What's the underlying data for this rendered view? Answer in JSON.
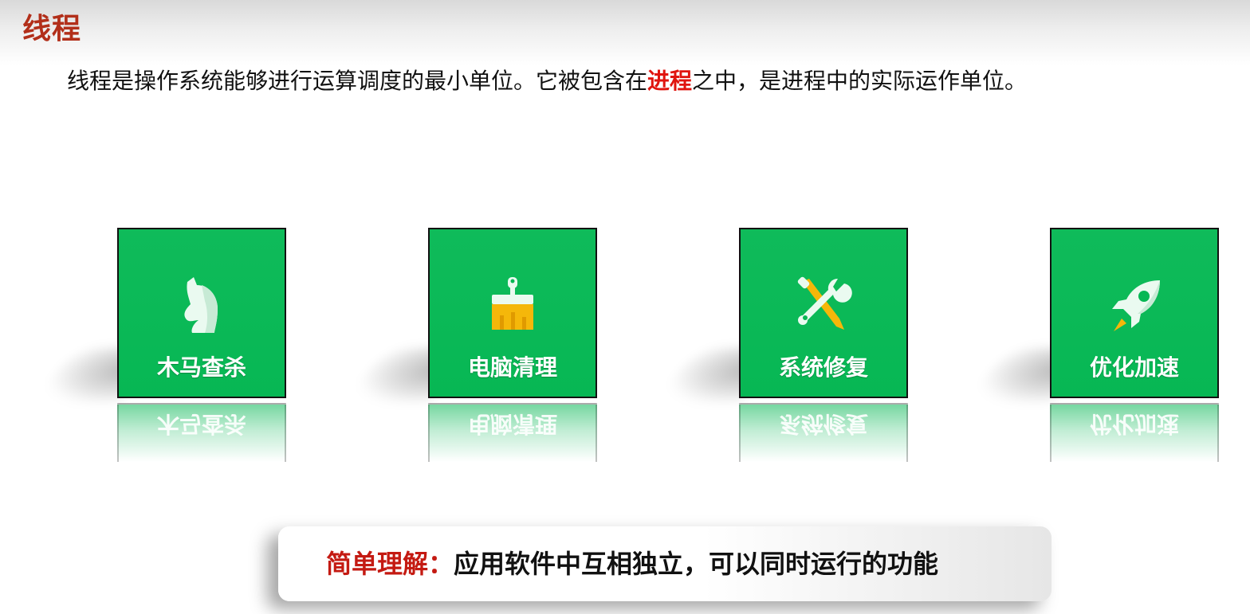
{
  "slide": {
    "title": "线程",
    "definition_part1": "线程是操作系统能够进行运算调度的最小单位。它被包含在",
    "definition_highlight": "进程",
    "definition_part2": "之中，是进程中的实际运作单位。"
  },
  "tiles": [
    {
      "label": "木马查杀",
      "icon": "horse-icon"
    },
    {
      "label": "电脑清理",
      "icon": "broom-icon"
    },
    {
      "label": "系统修复",
      "icon": "tools-icon"
    },
    {
      "label": "优化加速",
      "icon": "rocket-icon"
    }
  ],
  "summary": {
    "label": "简单理解：",
    "text": "应用软件中互相独立，可以同时运行的功能"
  },
  "colors": {
    "title": "#b22f1a",
    "highlight": "#e0150f",
    "tile_green": "#07b754",
    "summary_label": "#c41a12"
  }
}
